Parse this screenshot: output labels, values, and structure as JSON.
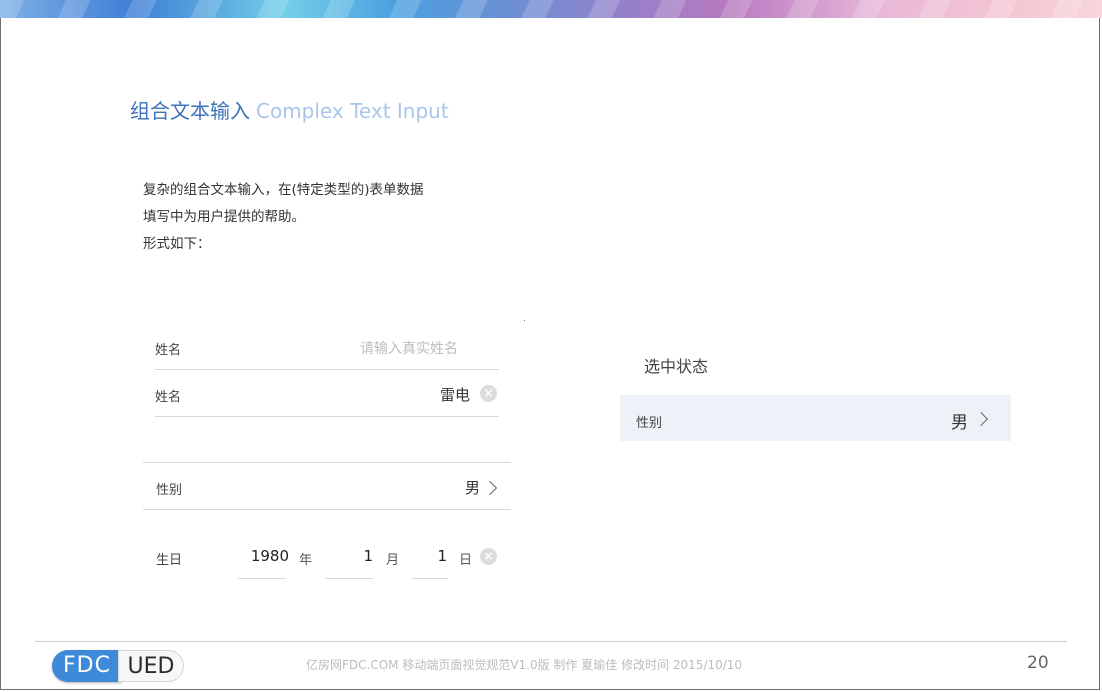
{
  "slide": {
    "title_cn": "组合文本输入",
    "title_en": "Complex Text Input",
    "description": [
      "复杂的组合文本输入，在(特定类型的)表单数据",
      "填写中为用户提供的帮助。",
      "形式如下："
    ]
  },
  "form": {
    "name_empty": {
      "label": "姓名",
      "placeholder": "请输入真实姓名"
    },
    "name_filled": {
      "label": "姓名",
      "value": "雷电",
      "clear_icon": "×"
    },
    "gender": {
      "label": "性别",
      "value": "男"
    },
    "birthday": {
      "label": "生日",
      "year": "1980",
      "year_unit": "年",
      "month": "1",
      "month_unit": "月",
      "day": "1",
      "day_unit": "日",
      "clear_icon": "×"
    }
  },
  "selected_state": {
    "title": "选中状态",
    "label": "性别",
    "value": "男",
    "background": "#eef2f8"
  },
  "footer": {
    "logo_left": "FDC",
    "logo_right": "UED",
    "text": "亿房网FDC.COM 移动端页面视觉规范V1.0版 制作 夏瑜佳 修改时间 2015/10/10",
    "page_number": "20"
  },
  "colors": {
    "title_cn": "#3d73b8",
    "title_en": "#a9c6ea",
    "logo_blue": "#3f8ad8"
  }
}
